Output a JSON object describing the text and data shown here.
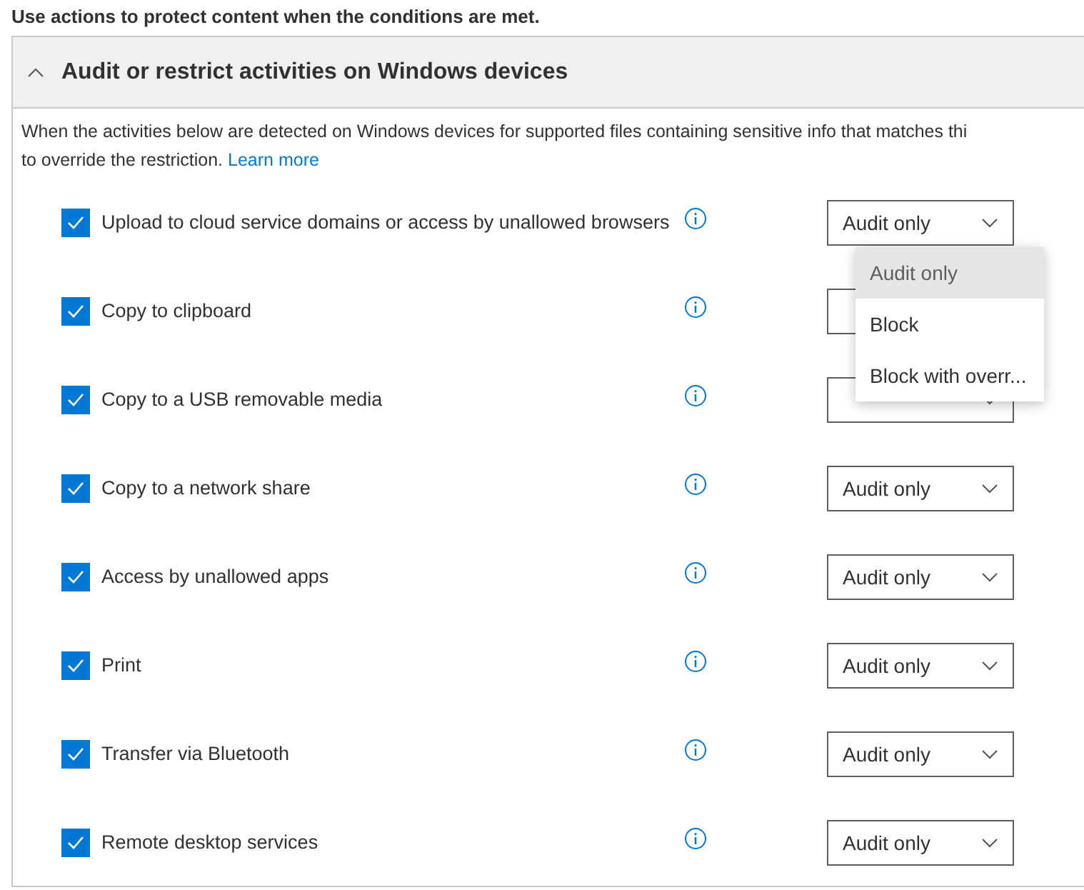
{
  "intro": "Use actions to protect content when the conditions are met.",
  "section": {
    "title": "Audit or restrict activities on Windows devices",
    "expanded": true,
    "description_line_1": "When the activities below are detected on Windows devices for supported files containing sensitive info that matches thi",
    "description_line_2": "to override the restriction.",
    "link": "Learn more",
    "activities": [
      {
        "label": "Upload to cloud service domains or access by unallowed browsers",
        "checked": true,
        "value": "Audit only",
        "menu": {
          "options": [
            {
              "label": "Audit only",
              "selected": true
            },
            {
              "label": "Block",
              "selected": false
            },
            {
              "label": "Block with overr...",
              "selected": false
            }
          ]
        }
      },
      {
        "label": "Copy to clipboard",
        "checked": true
      },
      {
        "label": "Copy to a USB removable media",
        "checked": true
      },
      {
        "label": "Copy to a network share",
        "checked": true,
        "value": "Audit only"
      },
      {
        "label": "Access by unallowed apps",
        "checked": true,
        "value": "Audit only"
      },
      {
        "label": "Print",
        "checked": true,
        "value": "Audit only"
      },
      {
        "label": "Transfer via Bluetooth",
        "checked": true,
        "value": "Audit only"
      },
      {
        "label": "Remote desktop services",
        "checked": true,
        "value": "Audit only"
      }
    ]
  }
}
